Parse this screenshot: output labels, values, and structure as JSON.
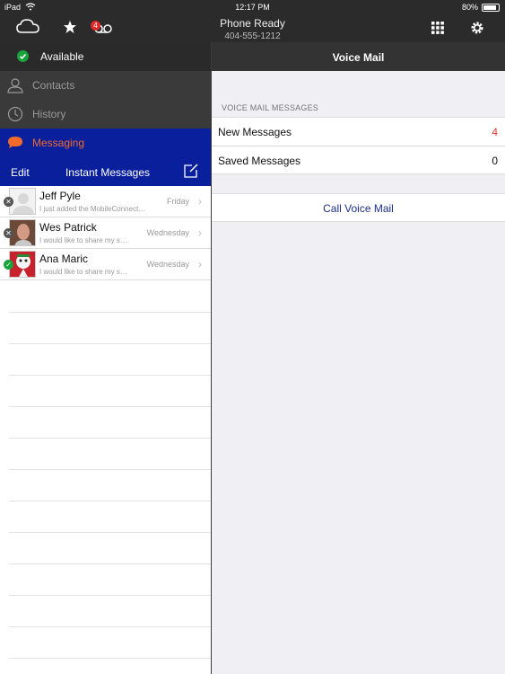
{
  "status_bar": {
    "device": "iPad",
    "time": "12:17 PM",
    "battery": "80%"
  },
  "header": {
    "phone_status": "Phone Ready",
    "phone_number": "404-555-1212",
    "voicemail_badge": "4"
  },
  "presence": {
    "label": "Available",
    "color": "#18a33a"
  },
  "nav": [
    {
      "label": "Contacts",
      "icon": "person-icon"
    },
    {
      "label": "History",
      "icon": "clock-icon"
    },
    {
      "label": "Messaging",
      "icon": "chat-bubble-icon"
    }
  ],
  "messaging_bar": {
    "edit_label": "Edit",
    "title": "Instant Messages"
  },
  "messages": [
    {
      "name": "Jeff Pyle",
      "preview": "I just added the MobileConnect…",
      "day": "Friday",
      "status": "offline"
    },
    {
      "name": "Wes Patrick",
      "preview": "I would like to share my s…",
      "day": "Wednesday",
      "status": "offline"
    },
    {
      "name": "Ana Maric",
      "preview": "I would like to share my s…",
      "day": "Wednesday",
      "status": "online"
    }
  ],
  "voicemail": {
    "title": "Voice Mail",
    "section_label": "VOICE MAIL MESSAGES",
    "rows": [
      {
        "label": "New Messages",
        "count": "4",
        "color": "#e0352b"
      },
      {
        "label": "Saved Messages",
        "count": "0",
        "color": "#111111"
      }
    ],
    "call_label": "Call Voice Mail"
  },
  "colors": {
    "accent_blue": "#0a1f9c",
    "accent_orange": "#f26b2b",
    "dark": "#2b2b2b"
  }
}
